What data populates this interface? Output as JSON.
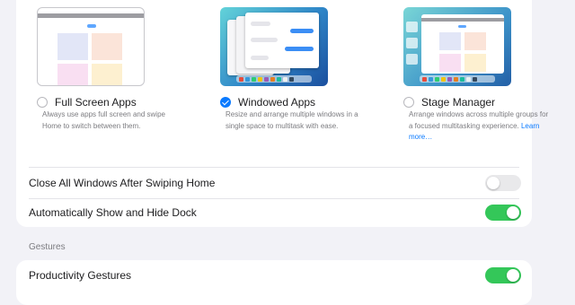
{
  "multitasking": {
    "options": [
      {
        "title": "Full Screen Apps",
        "description": "Always use apps full screen and swipe Home to switch between them.",
        "selected": false
      },
      {
        "title": "Windowed Apps",
        "description": "Resize and arrange multiple windows in a single space to multitask with ease.",
        "selected": true
      },
      {
        "title": "Stage Manager",
        "description": "Arrange windows across multiple groups for a focused multitasking experience.",
        "link": "Learn more…",
        "selected": false
      }
    ],
    "toggles": [
      {
        "label": "Close All Windows After Swiping Home",
        "on": false
      },
      {
        "label": "Automatically Show and Hide Dock",
        "on": true
      }
    ]
  },
  "gestures": {
    "header": "Gestures",
    "toggles": [
      {
        "label": "Productivity Gestures",
        "on": true
      }
    ]
  },
  "colors": {
    "accent": "#0a7aff",
    "toggle_on": "#34c759",
    "toggle_off": "#e9e9eb",
    "background": "#f2f2f7"
  },
  "icons": [
    "radio-unchecked-icon",
    "radio-checked-icon"
  ]
}
